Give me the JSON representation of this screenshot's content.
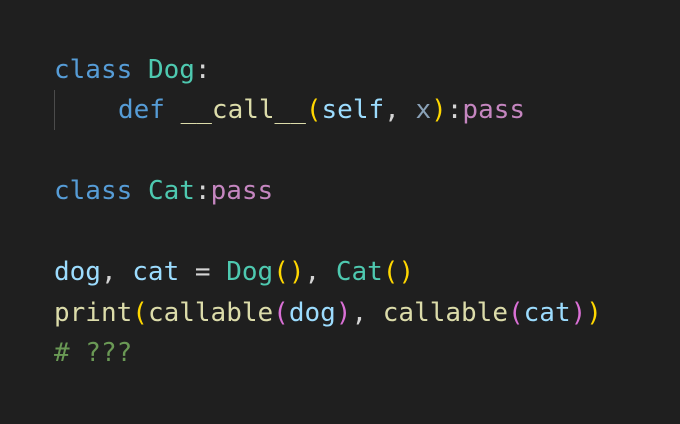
{
  "code": {
    "line1": {
      "kw": "class",
      "name": "Dog",
      "colon": ":"
    },
    "line2": {
      "kw": "def",
      "fname": "__call__",
      "open": "(",
      "p1": "self",
      "comma": ",",
      "p2": "x",
      "close": ")",
      "colon": ":",
      "pass": "pass"
    },
    "line4": {
      "kw": "class",
      "name": "Cat",
      "colon": ":",
      "pass": "pass"
    },
    "line6": {
      "v1": "dog",
      "comma1": ",",
      "v2": "cat",
      "eq": "=",
      "c1": "Dog",
      "o1": "(",
      "x1": ")",
      "comma2": ",",
      "c2": "Cat",
      "o2": "(",
      "x2": ")"
    },
    "line7": {
      "print": "print",
      "o1": "(",
      "callable1": "callable",
      "o2": "(",
      "arg1": "dog",
      "x2": ")",
      "comma": ",",
      "callable2": "callable",
      "o3": "(",
      "arg2": "cat",
      "x3": ")",
      "x1": ")"
    },
    "line8": {
      "comment": "# ???"
    }
  },
  "colors": {
    "background": "#1f1f1f",
    "keyword": "#569cd6",
    "class_name": "#4ec9b0",
    "function": "#dcdcaa",
    "control": "#c586c0",
    "parameter": "#9cdcfe",
    "comment": "#6a9955",
    "bracket_level1": "#ffd700",
    "bracket_level2": "#da70d6"
  }
}
